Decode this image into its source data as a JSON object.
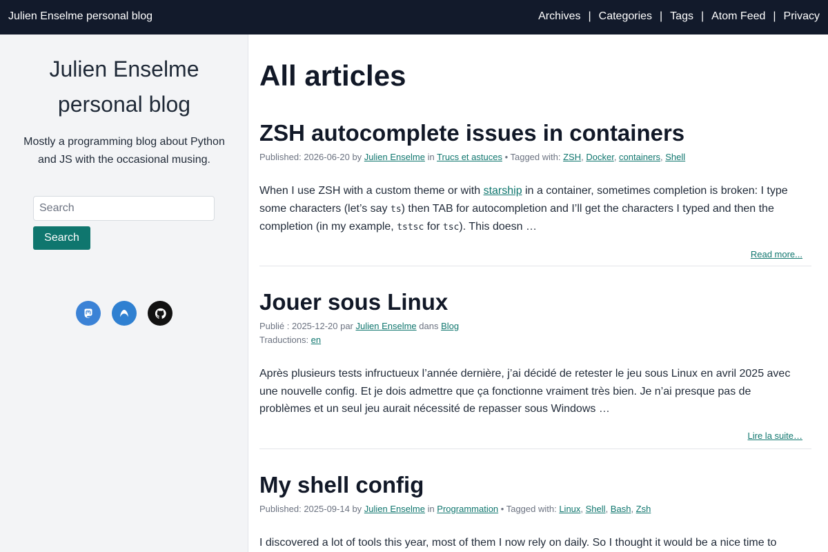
{
  "header": {
    "site_title": "Julien Enselme personal blog",
    "nav": [
      {
        "label": "Archives"
      },
      {
        "label": "Categories"
      },
      {
        "label": "Tags"
      },
      {
        "label": "Atom Feed"
      },
      {
        "label": "Privacy"
      }
    ],
    "separator": "|"
  },
  "sidebar": {
    "title_line1": "Julien Enselme",
    "title_line2": "personal blog",
    "description": "Mostly a programming blog about Python and JS with the occasional musing.",
    "search": {
      "placeholder": "Search",
      "button_label": "Search"
    },
    "socials": [
      {
        "icon": "mastodon-icon",
        "color": "#3b82d6"
      },
      {
        "icon": "bluesky-icon",
        "color": "#2f80d1"
      },
      {
        "icon": "github-icon",
        "color": "#121212"
      }
    ]
  },
  "main": {
    "page_title": "All articles",
    "articles": [
      {
        "title": "ZSH autocomplete issues in containers",
        "meta_published_prefix": "Published: ",
        "date": "2026-06-20",
        "by": " by ",
        "author": "Julien Enselme",
        "in": " in ",
        "category": "Trucs et astuces",
        "tags_prefix": " • Tagged with: ",
        "tags": [
          "ZSH",
          "Docker",
          "containers",
          "Shell"
        ],
        "summary_part1": "When I use ZSH with a custom theme or with ",
        "summary_link": "starship",
        "summary_part2": " in a container, sometimes completion is broken: I type some characters (let’s say ",
        "code1": "ts",
        "summary_part3": ") then TAB for autocompletion and I’ll get the characters I typed and then the completion (in my example, ",
        "code2": "tstsc",
        "summary_part4": " for ",
        "code3": "tsc",
        "summary_part5": "). This doesn …",
        "read_more": "Read more..."
      },
      {
        "title": "Jouer sous Linux",
        "meta_published_prefix": "Publié : ",
        "date": "2025-12-20",
        "by": " par ",
        "author": "Julien Enselme",
        "in": " dans ",
        "category": "Blog",
        "translations_prefix": "Traductions: ",
        "translation": "en",
        "summary": "Après plusieurs tests infructueux l’année dernière, j’ai décidé de retester le jeu sous Linux en avril 2025 avec une nouvelle config. Et je dois admettre que ça fonctionne vraiment très bien. Je n’ai presque pas de problèmes et un seul jeu aurait nécessité de repasser sous Windows …",
        "read_more": "Lire la suite…"
      },
      {
        "title": "My shell config",
        "meta_published_prefix": "Published: ",
        "date": "2025-09-14",
        "by": " by ",
        "author": "Julien Enselme",
        "in": " in ",
        "category": "Programmation",
        "tags_prefix": " • Tagged with: ",
        "tags": [
          "Linux",
          "Shell",
          "Bash",
          "Zsh"
        ],
        "summary": "I discovered a lot of tools this year, most of them I now rely on daily. So I thought it would be a nice time to share"
      }
    ]
  }
}
